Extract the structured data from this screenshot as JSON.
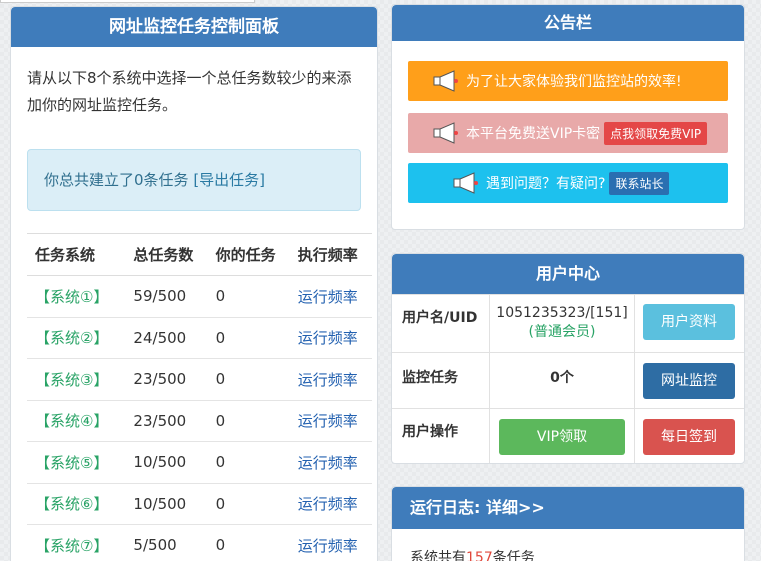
{
  "left_panel": {
    "title": "网址监控任务控制面板",
    "intro": "请从以下8个系统中选择一个总任务数较少的来添加你的网址监控任务。",
    "notice_prefix": "你总共建立了0条任务 ",
    "notice_link": "[导出任务]",
    "table": {
      "headers": [
        "任务系统",
        "总任务数",
        "你的任务",
        "执行频率"
      ],
      "rows": [
        {
          "system": "【系统①】",
          "total": "59/500",
          "mine": "0",
          "rate": "运行频率"
        },
        {
          "system": "【系统②】",
          "total": "24/500",
          "mine": "0",
          "rate": "运行频率"
        },
        {
          "system": "【系统③】",
          "total": "23/500",
          "mine": "0",
          "rate": "运行频率"
        },
        {
          "system": "【系统④】",
          "total": "23/500",
          "mine": "0",
          "rate": "运行频率"
        },
        {
          "system": "【系统⑤】",
          "total": "10/500",
          "mine": "0",
          "rate": "运行频率"
        },
        {
          "system": "【系统⑥】",
          "total": "10/500",
          "mine": "0",
          "rate": "运行频率"
        },
        {
          "system": "【系统⑦】",
          "total": "5/500",
          "mine": "0",
          "rate": "运行频率"
        }
      ]
    }
  },
  "announce": {
    "title": "公告栏",
    "item1": "为了让大家体验我们监控站的效率!",
    "item2": "本平台免费送VIP卡密",
    "item2_button": "点我领取免费VIP",
    "item3": "遇到问题？有疑问?",
    "item3_button": "联系站长"
  },
  "user_center": {
    "title": "用户中心",
    "row1_label": "用户名/UID",
    "row1_value": "1051235323/[151]",
    "row1_value2": "(普通会员)",
    "row1_button": "用户资料",
    "row2_label": "监控任务",
    "row2_value": "0个",
    "row2_button": "网址监控",
    "row3_label": "用户操作",
    "row3_button1": "VIP领取",
    "row3_button2": "每日签到"
  },
  "log": {
    "title": "运行日志: 详细>>",
    "text_prefix": "系统共有",
    "count": "157",
    "text_suffix": "条任务"
  },
  "colors": {
    "header_blue": "#3f7cbb",
    "orange": "#ff9f1a",
    "pink": "#e8a9a9",
    "cyan": "#1dc1ee",
    "green_text": "#29a366"
  }
}
